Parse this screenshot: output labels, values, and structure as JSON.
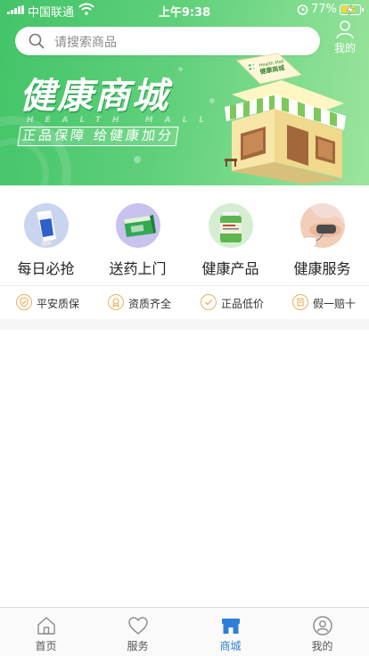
{
  "status_bar": {
    "carrier": "中国联通",
    "time": "上午9:38",
    "battery_percent": "77%",
    "battery_level": 0.77
  },
  "search": {
    "placeholder": "请搜索商品"
  },
  "header": {
    "me_label": "我的"
  },
  "banner": {
    "title": "健康商城",
    "subtitle_en": "HEALTH MALL",
    "slogan": "正品保障 给健康加分",
    "shop_sign_en": "Health Mall",
    "shop_sign_cn": "健康商城"
  },
  "categories": [
    {
      "label": "每日必抢",
      "icon": "tube-product-icon"
    },
    {
      "label": "送药上门",
      "icon": "medicine-box-icon"
    },
    {
      "label": "健康产品",
      "icon": "supplement-bottle-icon"
    },
    {
      "label": "健康服务",
      "icon": "blood-pressure-icon"
    }
  ],
  "guarantees": [
    {
      "label": "平安质保",
      "icon": "shield-icon"
    },
    {
      "label": "资质齐全",
      "icon": "certificate-icon"
    },
    {
      "label": "正品低价",
      "icon": "check-icon"
    },
    {
      "label": "假一赔十",
      "icon": "document-icon"
    }
  ],
  "tabbar": {
    "active": "商城",
    "accent_color": "#2e7fd8",
    "items": [
      {
        "label": "首页",
        "icon": "home-icon"
      },
      {
        "label": "服务",
        "icon": "heart-icon"
      },
      {
        "label": "商城",
        "icon": "shop-icon"
      },
      {
        "label": "我的",
        "icon": "user-icon"
      }
    ]
  },
  "colors": {
    "banner_green": "#4cc76d",
    "guarantee_gold": "#e6b25a"
  }
}
